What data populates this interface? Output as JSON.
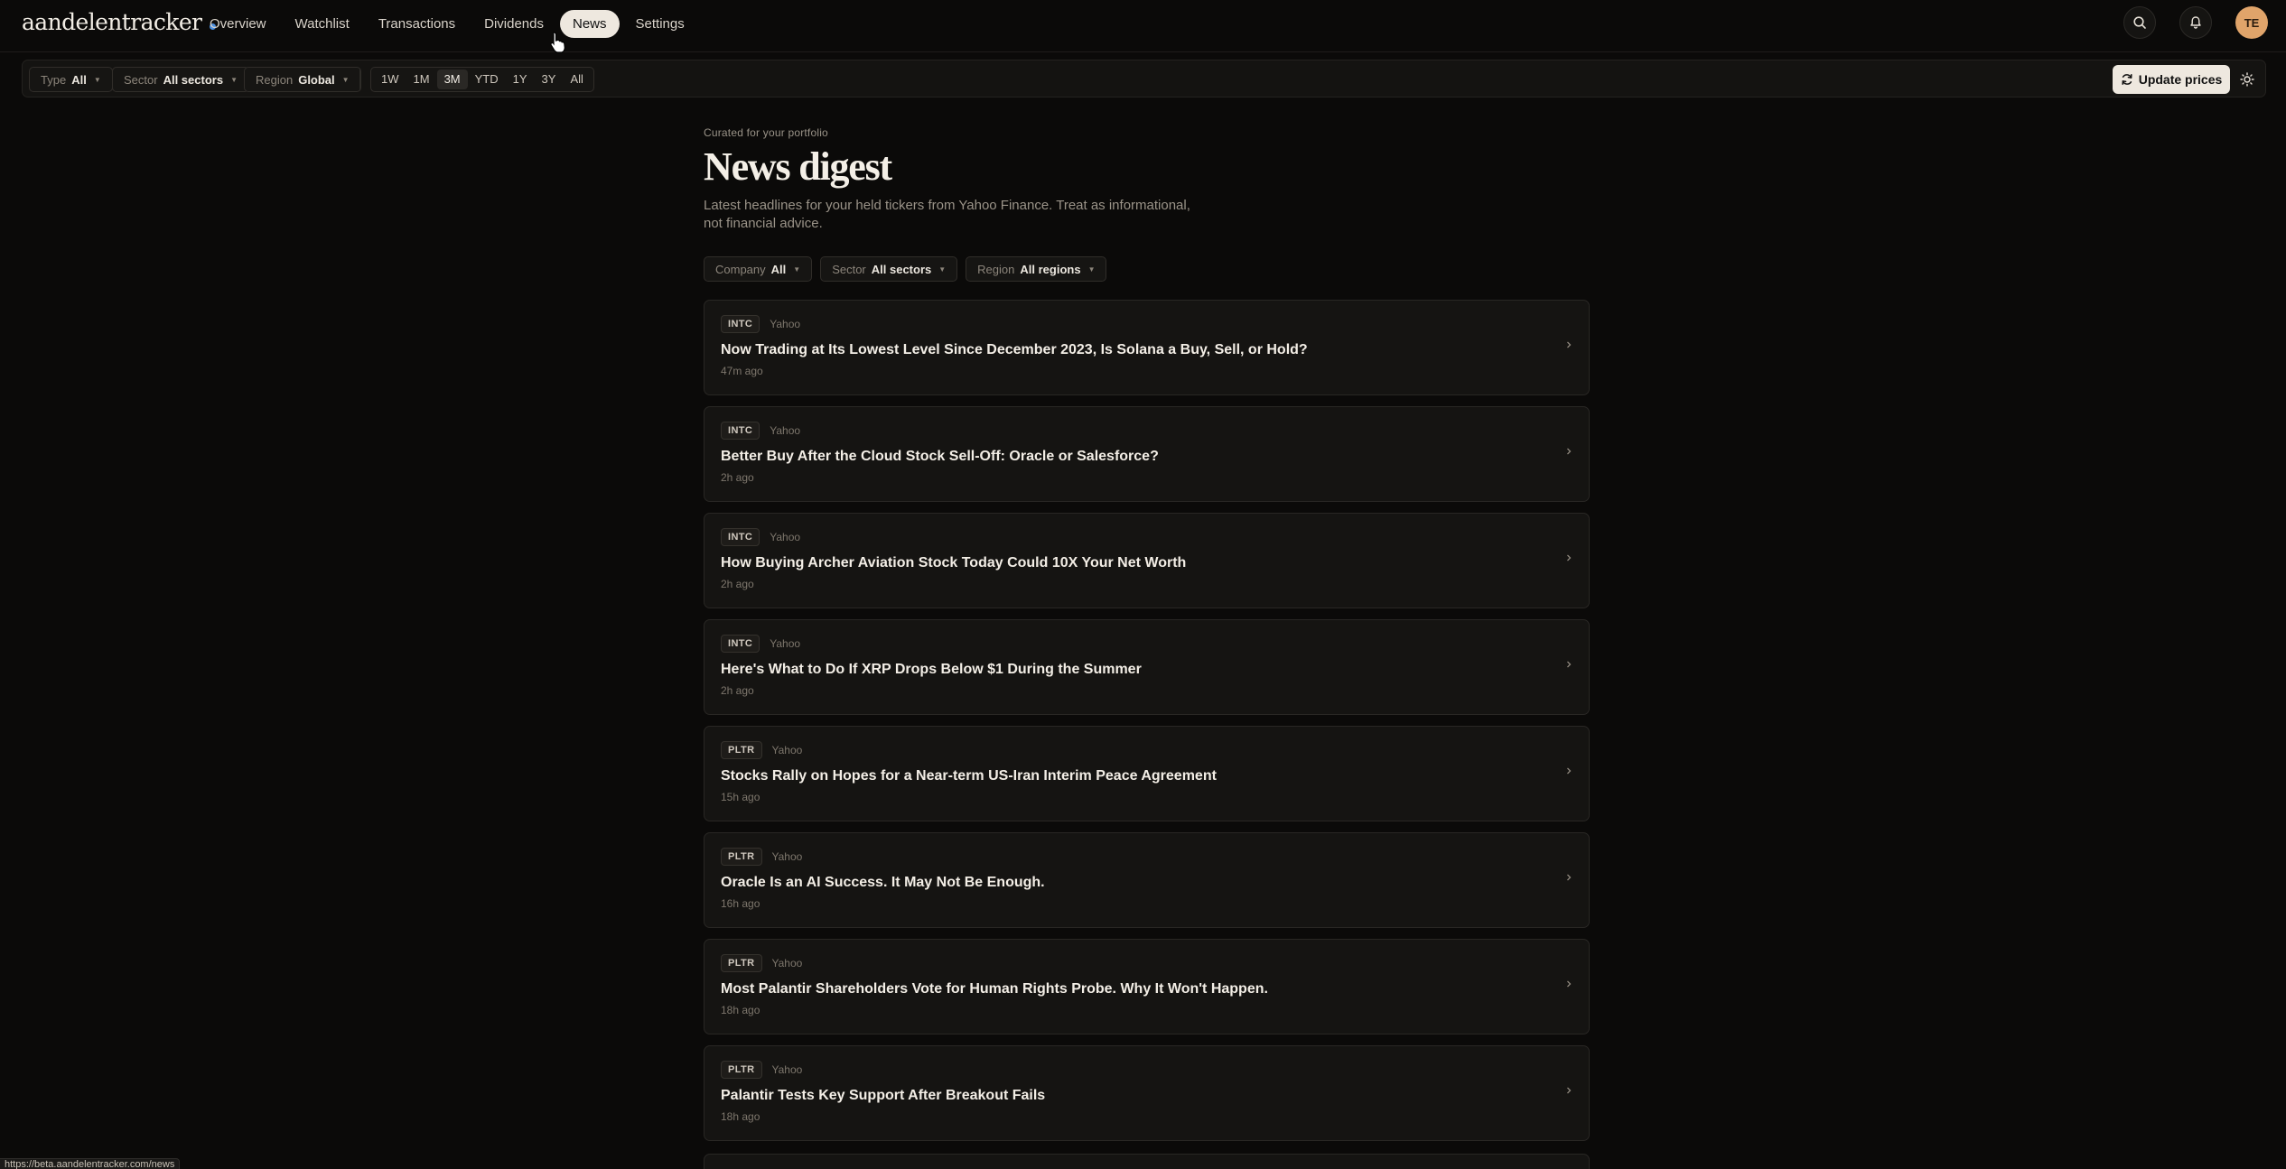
{
  "brand": "aandelentracker",
  "nav": {
    "links": [
      {
        "label": "Overview",
        "key": "overview"
      },
      {
        "label": "Watchlist",
        "key": "watchlist"
      },
      {
        "label": "Transactions",
        "key": "transactions"
      },
      {
        "label": "Dividends",
        "key": "dividends"
      },
      {
        "label": "News",
        "key": "news",
        "active": true
      },
      {
        "label": "Settings",
        "key": "settings"
      }
    ],
    "avatar_initials": "TE",
    "icons": [
      "search-icon",
      "bell-icon"
    ]
  },
  "toolbar": {
    "type": {
      "label": "Type",
      "value": "All"
    },
    "sector": {
      "label": "Sector",
      "value": "All sectors"
    },
    "region": {
      "label": "Region",
      "value": "Global"
    },
    "ranges": [
      "1W",
      "1M",
      "3M",
      "YTD",
      "1Y",
      "3Y",
      "All"
    ],
    "active_range": "3M",
    "update_label": "Update prices",
    "theme_icon": "sun-icon"
  },
  "page": {
    "eyebrow": "Curated for your portfolio",
    "title": "News digest",
    "subtitle": "Latest headlines for your held tickers from Yahoo Finance. Treat as informational, not financial advice."
  },
  "filters": {
    "company": {
      "label": "Company",
      "value": "All"
    },
    "sector": {
      "label": "Sector",
      "value": "All sectors"
    },
    "region": {
      "label": "Region",
      "value": "All regions"
    }
  },
  "news": [
    {
      "ticker": "INTC",
      "source": "Yahoo",
      "headline": "Now Trading at Its Lowest Level Since December 2023, Is Solana a Buy, Sell, or Hold?",
      "time": "47m ago"
    },
    {
      "ticker": "INTC",
      "source": "Yahoo",
      "headline": "Better Buy After the Cloud Stock Sell-Off: Oracle or Salesforce?",
      "time": "2h ago"
    },
    {
      "ticker": "INTC",
      "source": "Yahoo",
      "headline": "How Buying Archer Aviation Stock Today Could 10X Your Net Worth",
      "time": "2h ago"
    },
    {
      "ticker": "INTC",
      "source": "Yahoo",
      "headline": "Here's What to Do If XRP Drops Below $1 During the Summer",
      "time": "2h ago"
    },
    {
      "ticker": "PLTR",
      "source": "Yahoo",
      "headline": "Stocks Rally on Hopes for a Near-term US-Iran Interim Peace Agreement",
      "time": "15h ago"
    },
    {
      "ticker": "PLTR",
      "source": "Yahoo",
      "headline": "Oracle Is an AI Success. It May Not Be Enough.",
      "time": "16h ago"
    },
    {
      "ticker": "PLTR",
      "source": "Yahoo",
      "headline": "Most Palantir Shareholders Vote for Human Rights Probe. Why It Won't Happen.",
      "time": "18h ago"
    },
    {
      "ticker": "PLTR",
      "source": "Yahoo",
      "headline": "Palantir Tests Key Support After Breakout Fails",
      "time": "18h ago"
    }
  ],
  "status_url": "https://beta.aandelentracker.com/news",
  "colors": {
    "accent": "#eee8df",
    "brand_dot": "#4b8fe0",
    "avatar": "#e0a46a",
    "background": "#0b0a09"
  }
}
